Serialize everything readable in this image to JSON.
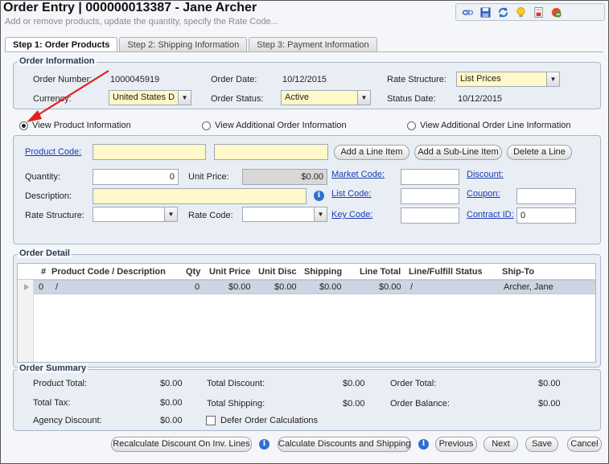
{
  "window": {
    "title": "Order Entry | 000000013387 - Jane Archer",
    "subtitle": "Add or remove products, update the quantity, specify the Rate Code..."
  },
  "toolbar": {
    "icons": [
      "link-icon",
      "save-icon",
      "refresh-icon",
      "lightbulb-icon",
      "report-icon",
      "close-record-icon"
    ]
  },
  "tabs": [
    {
      "label": "Step 1: Order Products",
      "active": true
    },
    {
      "label": "Step 2: Shipping Information",
      "active": false
    },
    {
      "label": "Step 3: Payment Information",
      "active": false
    }
  ],
  "order_info": {
    "legend": "Order Information",
    "order_number_label": "Order Number:",
    "order_number": "1000045919",
    "order_date_label": "Order Date:",
    "order_date": "10/12/2015",
    "rate_structure_label": "Rate Structure:",
    "rate_structure": "List Prices",
    "currency_label": "Currency:",
    "currency": "United States D",
    "order_status_label": "Order Status:",
    "order_status": "Active",
    "status_date_label": "Status Date:",
    "status_date": "10/12/2015"
  },
  "view_options": {
    "product": "View Product Information",
    "additional_order": "View Additional Order Information",
    "additional_line": "View Additional Order Line Information",
    "selected": "product"
  },
  "line_entry": {
    "product_code_label": "Product Code:",
    "product_code": "",
    "product_code_2": "",
    "add_line_item": "Add a Line Item",
    "add_sub_line_item": "Add a Sub-Line Item",
    "delete_line": "Delete a Line",
    "quantity_label": "Quantity:",
    "quantity": "0",
    "unit_price_label": "Unit Price:",
    "unit_price": "$0.00",
    "market_code_label": "Market Code:",
    "market_code": "",
    "discount_label": "Discount:",
    "description_label": "Description:",
    "description": "",
    "list_code_label": "List Code:",
    "list_code": "",
    "coupon_label": "Coupon:",
    "coupon": "",
    "rate_structure_label": "Rate Structure:",
    "rate_structure": "",
    "rate_code_label": "Rate Code:",
    "rate_code": "",
    "key_code_label": "Key Code:",
    "key_code": "",
    "contract_id_label": "Contract ID:",
    "contract_id": "0"
  },
  "order_detail": {
    "legend": "Order Detail",
    "columns": [
      "#",
      "Product Code / Description",
      "Qty",
      "Unit Price",
      "Unit Disc",
      "Shipping",
      "Line Total",
      "Line/Fulfill Status",
      "Ship-To"
    ],
    "rows": [
      {
        "num": "0",
        "product": "/",
        "qty": "0",
        "unit_price": "$0.00",
        "unit_disc": "$0.00",
        "shipping": "$0.00",
        "line_total": "$0.00",
        "status": "/",
        "ship_to": "Archer, Jane"
      }
    ]
  },
  "order_summary": {
    "legend": "Order Summary",
    "product_total_label": "Product Total:",
    "product_total": "$0.00",
    "total_discount_label": "Total Discount:",
    "total_discount": "$0.00",
    "order_total_label": "Order Total:",
    "order_total": "$0.00",
    "total_tax_label": "Total Tax:",
    "total_tax": "$0.00",
    "total_shipping_label": "Total Shipping:",
    "total_shipping": "$0.00",
    "order_balance_label": "Order Balance:",
    "order_balance": "$0.00",
    "agency_discount_label": "Agency Discount:",
    "agency_discount": "$0.00",
    "defer_label": "Defer Order Calculations"
  },
  "footer": {
    "recalc": "Recalculate Discount On Inv. Lines",
    "calc": "Calculate Discounts and Shipping",
    "previous": "Previous",
    "next": "Next",
    "save": "Save",
    "cancel": "Cancel"
  },
  "colors": {
    "annotation_arrow": "#e0201c",
    "required_field": "#fff8c8",
    "link": "#1a3bb0"
  }
}
